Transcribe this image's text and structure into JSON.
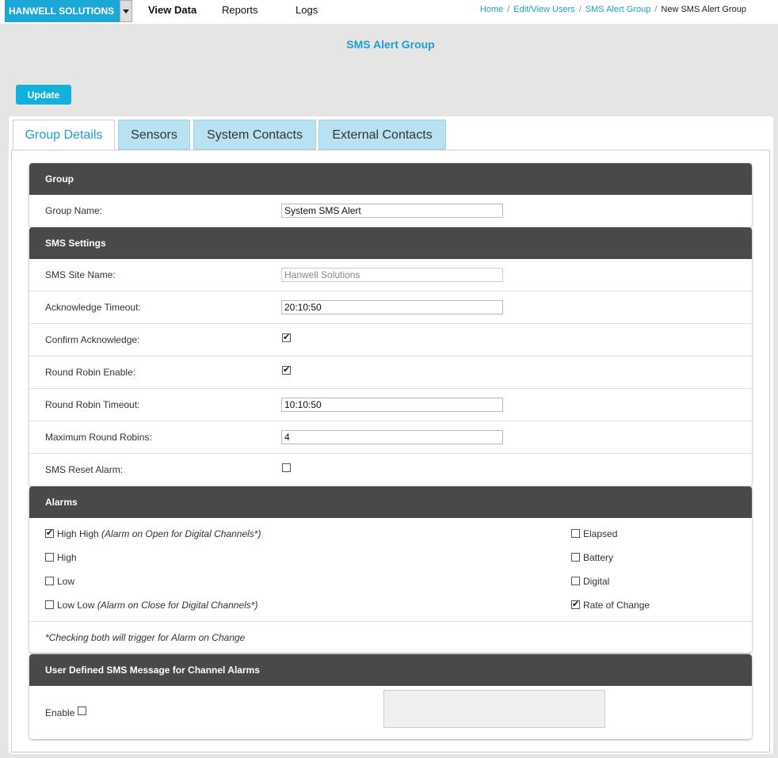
{
  "header": {
    "brand": "HANWELL SOLUTIONS",
    "nav": [
      "View Data",
      "Reports",
      "Logs"
    ],
    "breadcrumb": [
      "Home",
      "Edit/View Users",
      "SMS Alert Group",
      "New SMS Alert Group"
    ]
  },
  "page_title": "SMS Alert Group",
  "update_label": "Update",
  "tabs": [
    "Group Details",
    "Sensors",
    "System Contacts",
    "External Contacts"
  ],
  "group": {
    "title": "Group",
    "name_label": "Group Name:",
    "name_value": "System SMS Alert"
  },
  "sms_settings": {
    "title": "SMS Settings",
    "site_name_label": "SMS Site Name:",
    "site_name_value": "Hanwell Solutions",
    "ack_timeout_label": "Acknowledge Timeout:",
    "ack_timeout_value": "20:10:50",
    "confirm_ack_label": "Confirm Acknowledge:",
    "confirm_ack_checked": true,
    "rr_enable_label": "Round Robin Enable:",
    "rr_enable_checked": true,
    "rr_timeout_label": "Round Robin Timeout:",
    "rr_timeout_value": "10:10:50",
    "max_rr_label": "Maximum Round Robins:",
    "max_rr_value": "4",
    "reset_alarm_label": "SMS Reset Alarm:",
    "reset_alarm_checked": false
  },
  "alarms": {
    "title": "Alarms",
    "left": [
      {
        "label": "High High",
        "note": "(Alarm on Open for Digital Channels*)",
        "checked": true
      },
      {
        "label": "High",
        "note": "",
        "checked": false
      },
      {
        "label": "Low",
        "note": "",
        "checked": false
      },
      {
        "label": "Low Low",
        "note": "(Alarm on Close for Digital Channels*)",
        "checked": false
      }
    ],
    "right": [
      {
        "label": "Elapsed",
        "checked": false
      },
      {
        "label": "Battery",
        "checked": false
      },
      {
        "label": "Digital",
        "checked": false
      },
      {
        "label": "Rate of Change",
        "checked": true
      }
    ],
    "footnote": "*Checking both will trigger for Alarm on Change"
  },
  "user_message": {
    "title": "User Defined SMS Message for Channel Alarms",
    "enable_label": "Enable",
    "enable_checked": false
  }
}
